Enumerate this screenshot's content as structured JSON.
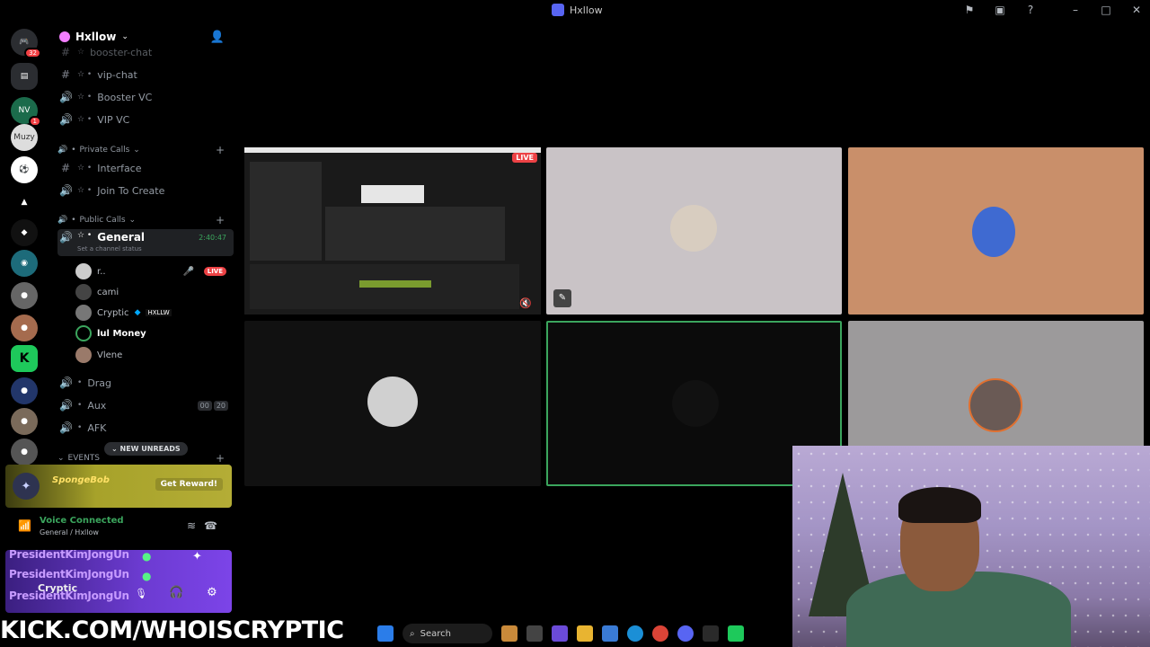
{
  "window": {
    "title": "Hxllow"
  },
  "server": {
    "name": "Hxllow"
  },
  "rail": {
    "home_badge": "32",
    "nv_badge": "1",
    "muzy_label": "Muzy"
  },
  "channels": {
    "booster_chat": "booster-chat",
    "vip_chat": "vip-chat",
    "booster_vc": "Booster VC",
    "vip_vc": "VIP VC",
    "private_calls": "Private Calls",
    "interface": "Interface",
    "join_to_create": "Join To Create",
    "public_calls": "Public Calls",
    "general": "General",
    "general_time": "2:40:47",
    "general_status": "Set a channel status",
    "drag": "Drag",
    "aux": "Aux",
    "aux_count": "00",
    "aux_limit": "20",
    "afk": "AFK",
    "events": "EVENTS",
    "new_unreads": "NEW UNREADS"
  },
  "voice_users": [
    {
      "name": "r..",
      "live": "LIVE"
    },
    {
      "name": "cami"
    },
    {
      "name": "Cryptic",
      "tag": "HXLLW"
    },
    {
      "name": "lul Money"
    },
    {
      "name": "Vlene"
    }
  ],
  "reward": {
    "logo": "SpongeBob",
    "button": "Get Reward!"
  },
  "voice": {
    "title": "Voice Connected",
    "subtitle": "General / Hxllow"
  },
  "user_panel": {
    "name": "PresidentKimJongUn",
    "display": "Cryptic"
  },
  "stage": {
    "live": "LIVE"
  },
  "overlay": {
    "kick": "KICK.COM/WHOISCRYPTIC"
  },
  "taskbar": {
    "search": "Search"
  }
}
